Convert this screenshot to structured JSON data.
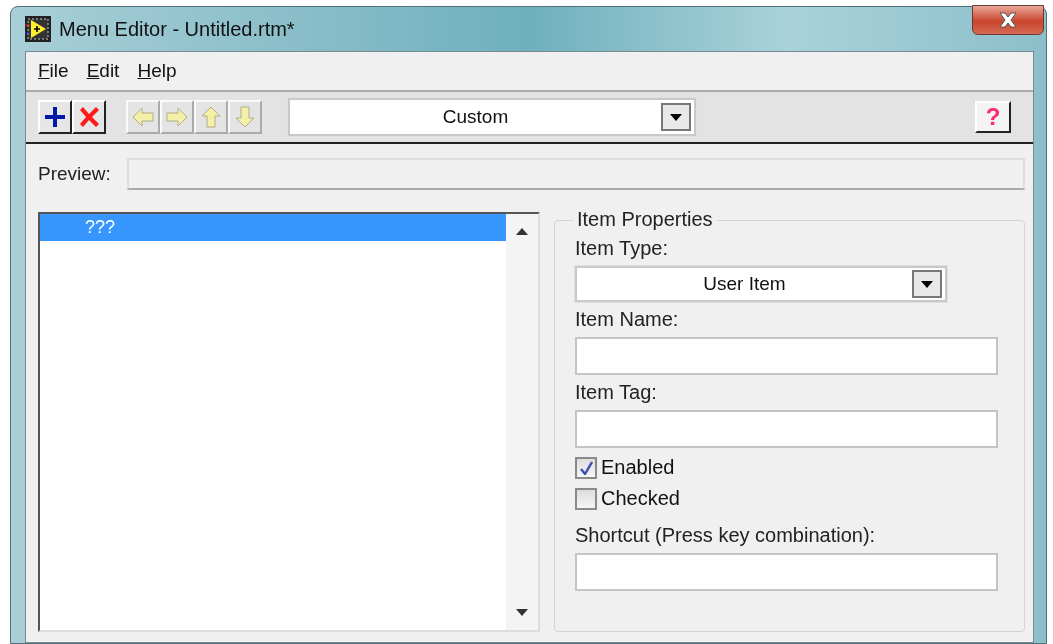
{
  "window": {
    "title": "Menu Editor - Untitled.rtm*"
  },
  "menu": [
    {
      "label": "File"
    },
    {
      "label": "Edit"
    },
    {
      "label": "Help"
    }
  ],
  "toolbar": {
    "buttons": [
      {
        "kind": "add",
        "disabled": false
      },
      {
        "kind": "delete",
        "disabled": false
      },
      {
        "kind": "left",
        "disabled": true
      },
      {
        "kind": "right",
        "disabled": true
      },
      {
        "kind": "up",
        "disabled": true
      },
      {
        "kind": "down",
        "disabled": true
      }
    ],
    "menu_type": "Custom",
    "help": "?"
  },
  "preview": {
    "label": "Preview:"
  },
  "tree": {
    "items": [
      {
        "label": "???",
        "selected": true
      }
    ]
  },
  "properties": {
    "title": "Item Properties",
    "item_type_label": "Item Type:",
    "item_type": "User Item",
    "item_name_label": "Item Name:",
    "item_tag_label": "Item Tag:",
    "options": [
      {
        "label": "Enabled",
        "checked": true
      },
      {
        "label": "Checked",
        "checked": false
      }
    ],
    "shortcut_label": "Shortcut (Press key combination):"
  }
}
